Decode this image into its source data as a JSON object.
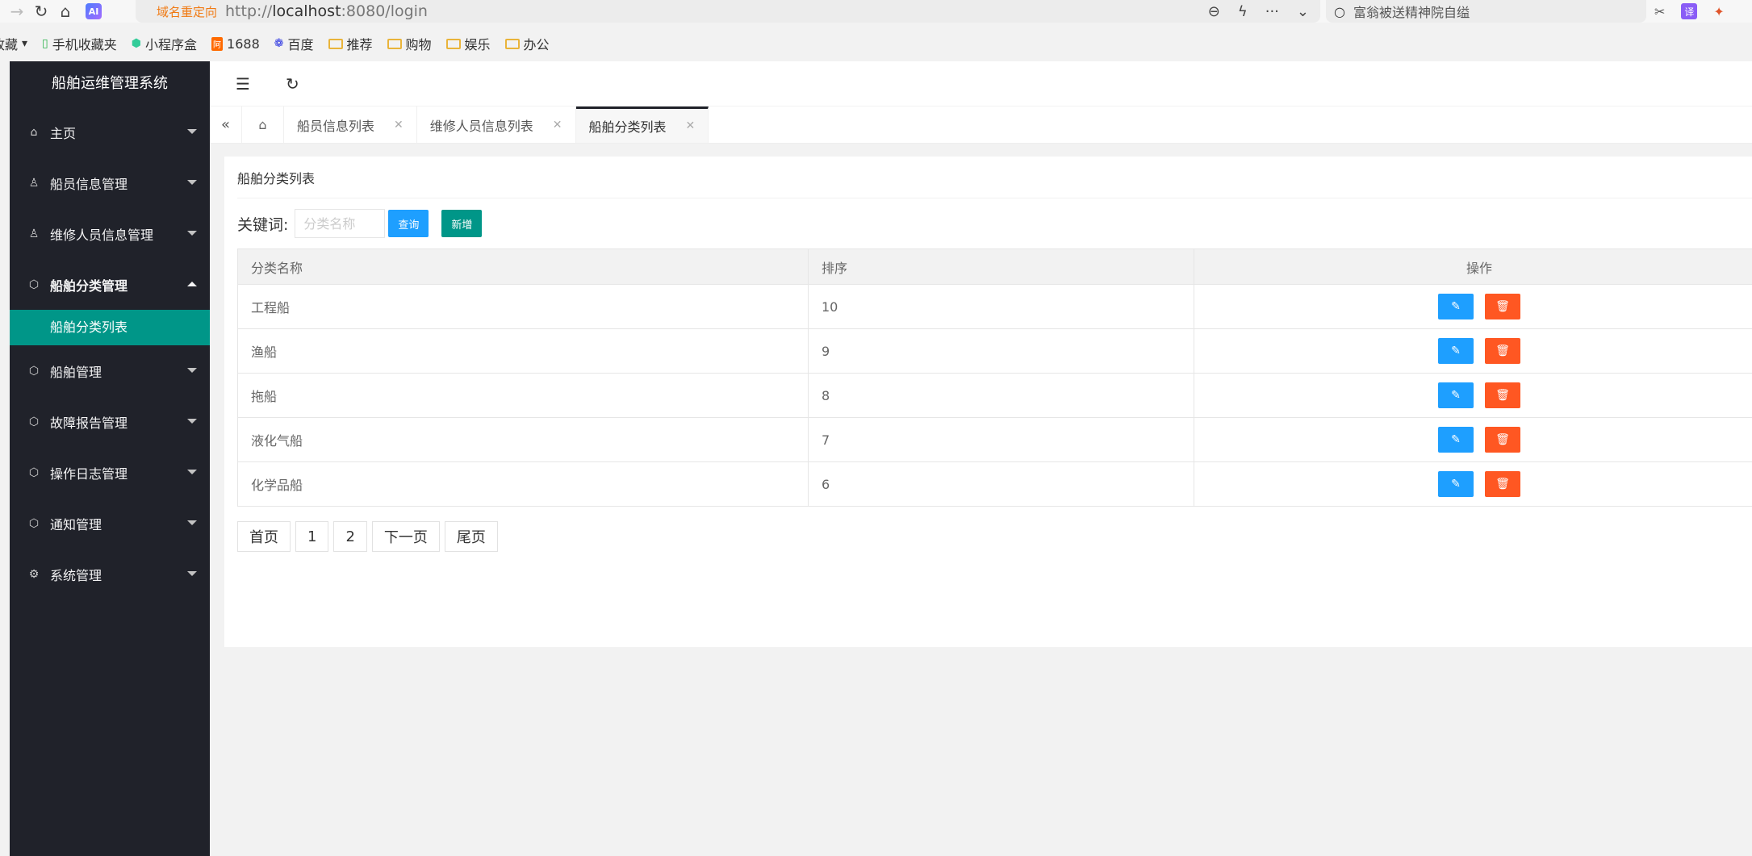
{
  "browser": {
    "redirect_label": "域名重定向",
    "url_prefix": "http://",
    "url_host": "localhost",
    "url_rest": ":8080/login",
    "search_text": "富翁被送精神院自缢",
    "ai_label": "AI",
    "translate_label": "译"
  },
  "bookmarks": [
    {
      "label": "收藏"
    },
    {
      "label": "手机收藏夹"
    },
    {
      "label": "小程序盒"
    },
    {
      "label": "1688"
    },
    {
      "label": "百度"
    },
    {
      "label": "推荐"
    },
    {
      "label": "购物"
    },
    {
      "label": "娱乐"
    },
    {
      "label": "办公"
    }
  ],
  "sidebar": {
    "title": "船舶运维管理系统",
    "items": [
      {
        "label": "主页"
      },
      {
        "label": "船员信息管理"
      },
      {
        "label": "维修人员信息管理"
      },
      {
        "label": "船舶分类管理"
      },
      {
        "label": "船舶管理"
      },
      {
        "label": "故障报告管理"
      },
      {
        "label": "操作日志管理"
      },
      {
        "label": "通知管理"
      },
      {
        "label": "系统管理"
      }
    ],
    "active_sub": "船舶分类列表"
  },
  "tabs": [
    {
      "label": "船员信息列表"
    },
    {
      "label": "维修人员信息列表"
    },
    {
      "label": "船舶分类列表"
    }
  ],
  "content": {
    "title": "船舶分类列表",
    "keyword_label": "关键词:",
    "keyword_placeholder": "分类名称",
    "query_button": "查询",
    "add_button": "新增",
    "columns": [
      "分类名称",
      "排序",
      "操作"
    ],
    "rows": [
      {
        "name": "工程船",
        "order": "10"
      },
      {
        "name": "渔船",
        "order": "9"
      },
      {
        "name": "拖船",
        "order": "8"
      },
      {
        "name": "液化气船",
        "order": "7"
      },
      {
        "name": "化学品船",
        "order": "6"
      }
    ],
    "pager": [
      "首页",
      "1",
      "2",
      "下一页",
      "尾页"
    ]
  }
}
